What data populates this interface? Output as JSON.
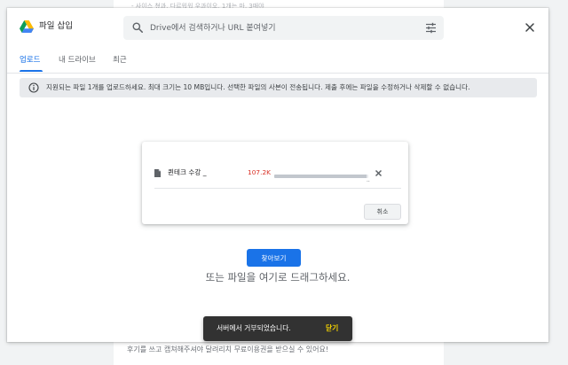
{
  "background": {
    "top_text": "- 사이스 쳤과, 다르워워 우과이오, 1개는 마, 3매야",
    "bottom_text": "후기를 쓰고 캡쳐해주셔야 달려리치 무료이용권을 받으실 수 있어요!"
  },
  "dialog": {
    "title": "파일 삽입",
    "logo_icon": "google-drive-icon",
    "close_icon": "close-icon"
  },
  "search": {
    "placeholder": "Drive에서 검색하거나 URL 붙여넣기",
    "value": "",
    "icon": "search-icon",
    "filter_icon": "tune-icon"
  },
  "tabs": [
    {
      "label": "업로드",
      "active": true
    },
    {
      "label": "내 드라이브",
      "active": false
    },
    {
      "label": "최근",
      "active": false
    }
  ],
  "info_banner": {
    "icon": "info-icon",
    "text": "지원되는 파일 1개를 업로드하세요. 최대 크기는 10 MB입니다. 선택한 파일의 사본이 전송됩니다. 제출 후에는 파일을 수정하거나 삭제할 수 없습니다."
  },
  "upload": {
    "file_name": "퀸테크 수강 _",
    "file_size": "107.2K",
    "progress_fraction": 0.98,
    "progress_end_mark": "..",
    "file_icon": "document-icon",
    "remove_icon": "close-icon",
    "cancel_label": "취소"
  },
  "browse": {
    "button_label": "찾아보기",
    "drag_text": "또는 파일을 여기로 드래그하세요."
  },
  "snackbar": {
    "message": "서버에서 거부되었습니다.",
    "action": "닫기"
  },
  "colors": {
    "accent": "#1a73e8",
    "error": "#d93025",
    "snackbar_action": "#f5d400"
  }
}
